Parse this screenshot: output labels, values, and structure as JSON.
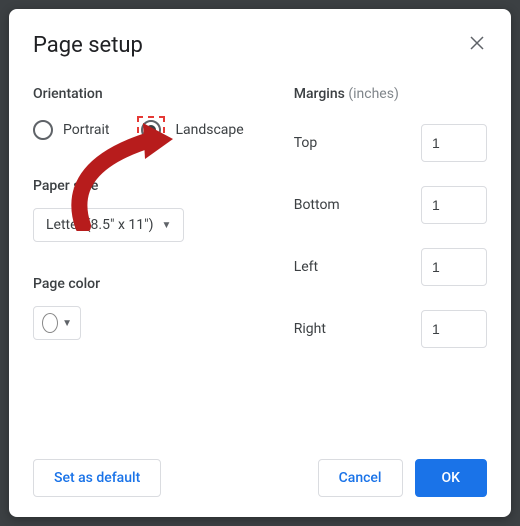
{
  "title": "Page setup",
  "orientation": {
    "label": "Orientation",
    "portrait": "Portrait",
    "landscape": "Landscape",
    "selected": "landscape"
  },
  "paper": {
    "label": "Paper size",
    "value": "Letter (8.5\" x 11\")"
  },
  "color": {
    "label": "Page color",
    "value": "#ffffff"
  },
  "margins": {
    "label": "Margins",
    "unit_label": "(inches)",
    "top_label": "Top",
    "bottom_label": "Bottom",
    "left_label": "Left",
    "right_label": "Right",
    "top": "1",
    "bottom": "1",
    "left": "1",
    "right": "1"
  },
  "buttons": {
    "set_default": "Set as default",
    "cancel": "Cancel",
    "ok": "OK"
  }
}
